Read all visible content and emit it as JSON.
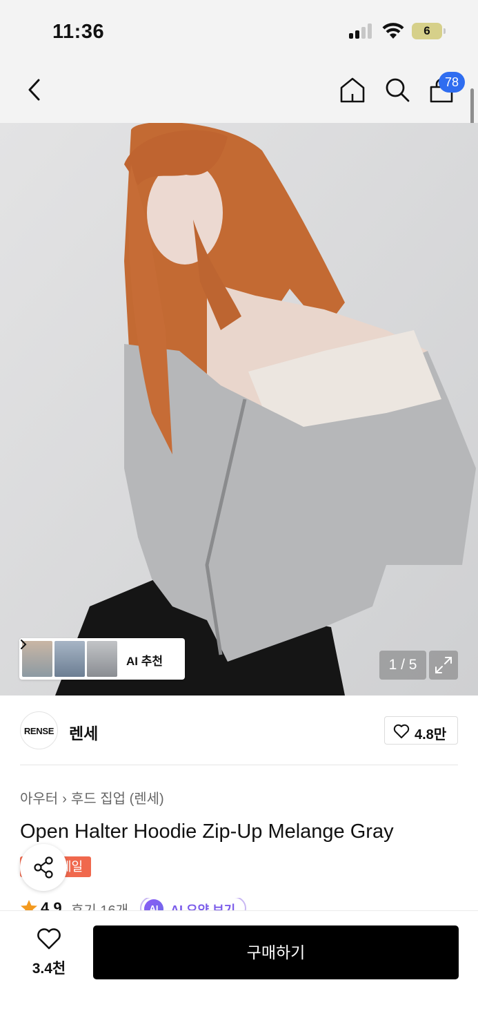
{
  "status_bar": {
    "time": "11:36",
    "battery": "6"
  },
  "nav": {
    "cart_count": "78"
  },
  "gallery": {
    "ai_recommend_label": "AI 추천",
    "counter": "1 / 5"
  },
  "brand": {
    "logo_text": "RENSE",
    "name": "렌세",
    "likes": "4.8만"
  },
  "product": {
    "breadcrumb": [
      "아우터",
      "후드 집업 (렌세)"
    ],
    "title": "Open Halter Hoodie Zip-Up Melange Gray",
    "sale_badge": "세일",
    "rating": "4.9",
    "reviews": "후기 16개",
    "ai_summary": "AI 요약 보기",
    "ai_badge": "AI"
  },
  "bottom": {
    "wish_count": "3.4천",
    "buy_label": "구매하기"
  },
  "colors": {
    "accent_blue": "#2f6df0",
    "sale": "#f0684d",
    "ai_purple": "#7b5cea",
    "buy": "#000000"
  }
}
